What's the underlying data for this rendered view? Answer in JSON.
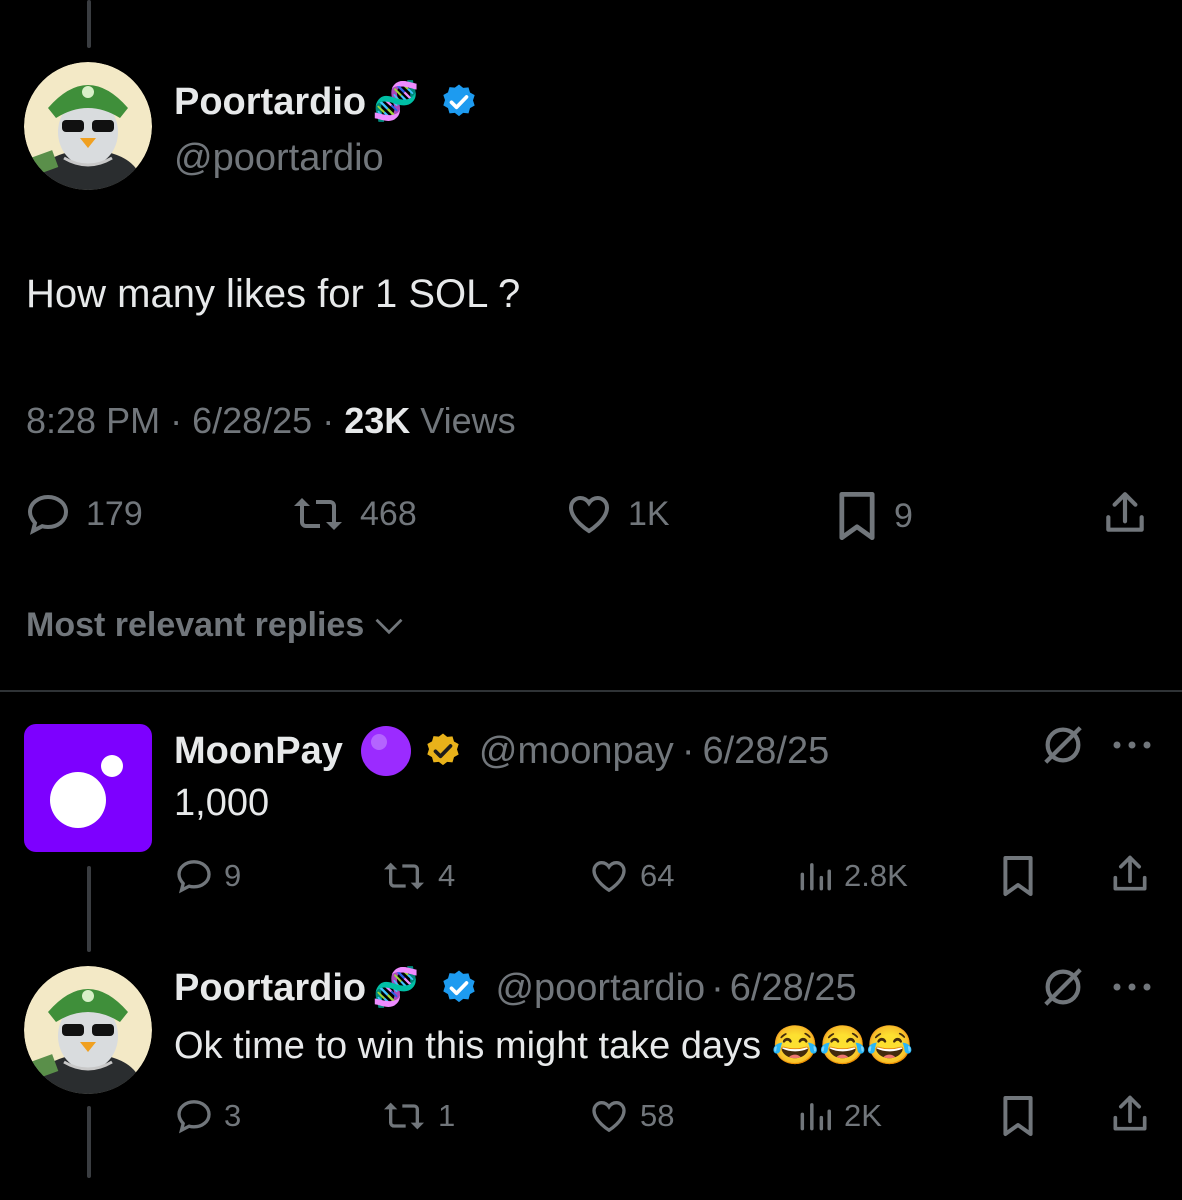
{
  "main_post": {
    "display_name": "Poortardio",
    "name_emoji": "🧬",
    "verified": "blue-verified-badge",
    "handle": "@poortardio",
    "text": "How many likes for 1 SOL ?",
    "time": "8:28 PM",
    "date": "6/28/25",
    "views_count": "23K",
    "views_label": "Views",
    "replies": "179",
    "reposts": "468",
    "likes": "1K",
    "bookmarks": "9"
  },
  "replies_sort": {
    "label": "Most relevant replies"
  },
  "reply_1": {
    "display_name": "MoonPay",
    "name_emoji": "🟣",
    "verified": "gold-verified-badge",
    "handle": "@moonpay",
    "date": "6/28/25",
    "text": "1,000",
    "replies": "9",
    "reposts": "4",
    "likes": "64",
    "views": "2.8K"
  },
  "reply_2": {
    "display_name": "Poortardio",
    "name_emoji": "🧬",
    "verified": "blue-verified-badge",
    "handle": "@poortardio",
    "date": "6/28/25",
    "text": "Ok time to win this might take days 😂😂😂",
    "replies": "3",
    "reposts": "1",
    "likes": "58",
    "views": "2K"
  },
  "colors": {
    "background": "#000000",
    "text": "#e7e9ea",
    "muted": "#71767b",
    "blue_badge": "#1d9bf0",
    "gold_badge": "#e8b21a",
    "moonpay_purple": "#7d00ff"
  }
}
